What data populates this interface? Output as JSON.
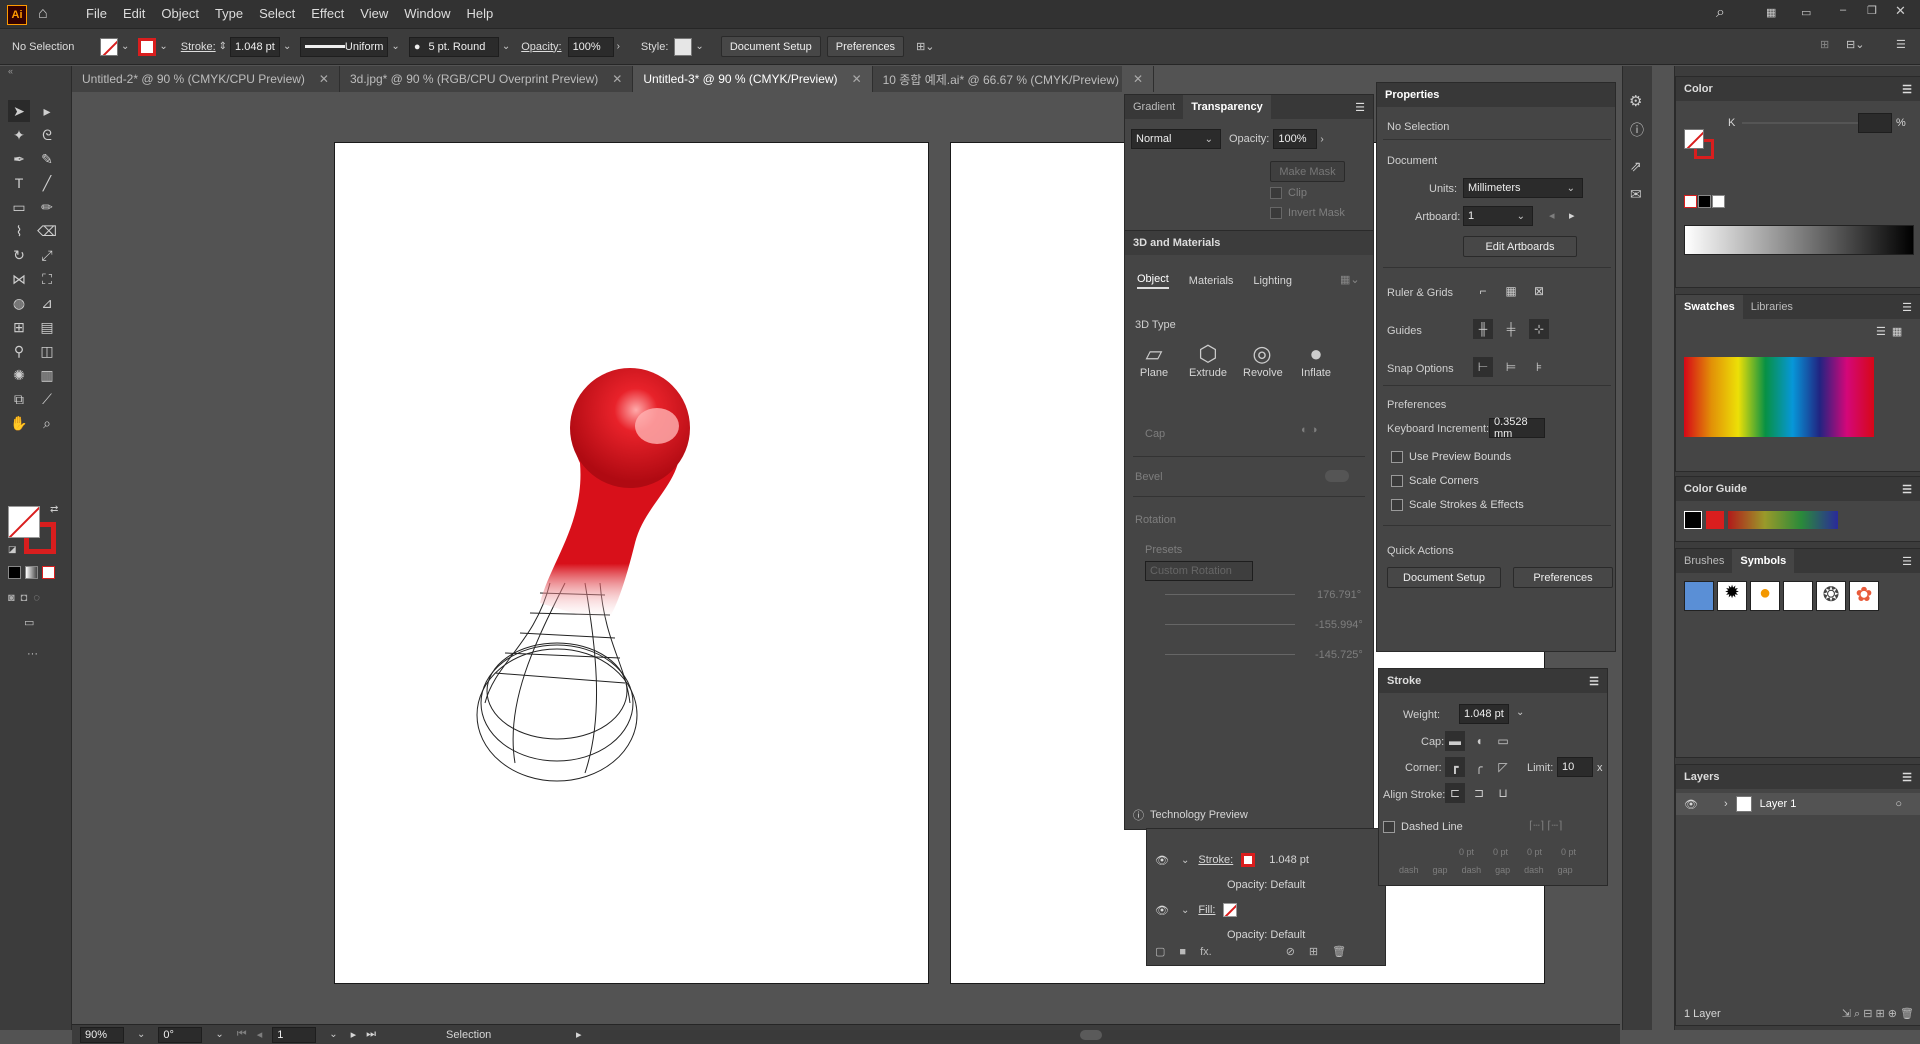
{
  "app": {
    "logo": "Ai"
  },
  "menu": [
    "File",
    "Edit",
    "Object",
    "Type",
    "Select",
    "Effect",
    "View",
    "Window",
    "Help"
  ],
  "control": {
    "selection": "No Selection",
    "stroke_label": "Stroke:",
    "stroke_value": "1.048 pt",
    "profile": "Uniform",
    "brush": "5 pt. Round",
    "opacity_label": "Opacity:",
    "opacity_value": "100%",
    "style_label": "Style:",
    "doc_setup": "Document Setup",
    "preferences": "Preferences"
  },
  "tabs": [
    {
      "label": "Untitled-2* @ 90 % (CMYK/CPU Preview)"
    },
    {
      "label": "3d.jpg* @ 90 % (RGB/CPU Overprint Preview)"
    },
    {
      "label": "Untitled-3* @ 90 % (CMYK/Preview)"
    },
    {
      "label": "10 종합 예제.ai* @ 66.67 % (CMYK/Preview)"
    }
  ],
  "transparency": {
    "tab_gradient": "Gradient",
    "tab_transparency": "Transparency",
    "blend": "Normal",
    "opacity_label": "Opacity:",
    "opacity": "100%",
    "make_mask": "Make Mask",
    "clip": "Clip",
    "invert": "Invert Mask"
  },
  "threed": {
    "title": "3D and Materials",
    "tab_object": "Object",
    "tab_materials": "Materials",
    "tab_lighting": "Lighting",
    "type_label": "3D Type",
    "types": [
      "Plane",
      "Extrude",
      "Revolve",
      "Inflate"
    ],
    "cap": "Cap",
    "bevel": "Bevel",
    "rotation": "Rotation",
    "presets": "Presets",
    "preset_value": "Custom Rotation",
    "rot1": "176.791°",
    "rot2": "-155.994°",
    "rot3": "-145.725°",
    "tech": "Technology Preview"
  },
  "appearance": {
    "stroke_label": "Stroke:",
    "stroke_value": "1.048 pt",
    "opacity1": "Opacity: Default",
    "fill_label": "Fill:",
    "opacity2": "Opacity: Default"
  },
  "properties": {
    "title": "Properties",
    "no_selection": "No Selection",
    "document": "Document",
    "units_label": "Units:",
    "units": "Millimeters",
    "artboard_label": "Artboard:",
    "artboard": "1",
    "edit_artboards": "Edit Artboards",
    "ruler_grids": "Ruler & Grids",
    "guides": "Guides",
    "snap": "Snap Options",
    "preferences": "Preferences",
    "keyboard_label": "Keyboard Increment:",
    "keyboard_value": "0.3528 mm",
    "use_preview": "Use Preview Bounds",
    "scale_corners": "Scale Corners",
    "scale_strokes": "Scale Strokes & Effects",
    "quick_actions": "Quick Actions",
    "doc_setup_btn": "Document Setup",
    "prefs_btn": "Preferences"
  },
  "stroke": {
    "title": "Stroke",
    "weight_label": "Weight:",
    "weight": "1.048 pt",
    "cap_label": "Cap:",
    "corner_label": "Corner:",
    "limit_label": "Limit:",
    "limit": "10",
    "limit_unit": "x",
    "align_label": "Align Stroke:",
    "dashed": "Dashed Line",
    "dash_values": [
      "0 pt",
      "0 pt",
      "0 pt",
      "0 pt"
    ],
    "dash_labels": [
      "dash",
      "gap",
      "dash",
      "gap",
      "dash",
      "gap"
    ]
  },
  "color": {
    "title": "Color",
    "channel": "K",
    "percent": "%"
  },
  "swatches": {
    "tab_swatches": "Swatches",
    "tab_libraries": "Libraries"
  },
  "color_guide": {
    "title": "Color Guide"
  },
  "symbols": {
    "tab_brushes": "Brushes",
    "tab_symbols": "Symbols"
  },
  "layers": {
    "title": "Layers",
    "layer_name": "Layer 1",
    "count": "1 Layer"
  },
  "status": {
    "zoom": "90%",
    "angle": "0°",
    "artboard": "1",
    "tool": "Selection"
  },
  "colors": {
    "accent": "#d91e1e",
    "bg": "#535353",
    "panel": "#454545"
  }
}
